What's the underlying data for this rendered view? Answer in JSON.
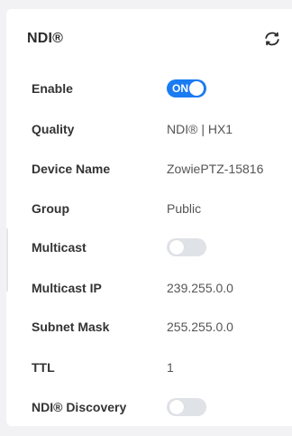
{
  "panel": {
    "title": "NDI®",
    "refresh_icon": "refresh-icon"
  },
  "rows": [
    {
      "label": "Enable",
      "type": "toggle",
      "state": "on",
      "toggle_text": "ON"
    },
    {
      "label": "Quality",
      "type": "text",
      "value": "NDI® | HX1"
    },
    {
      "label": "Device Name",
      "type": "text",
      "value": "ZowiePTZ-15816"
    },
    {
      "label": "Group",
      "type": "text",
      "value": "Public"
    },
    {
      "label": "Multicast",
      "type": "toggle",
      "state": "off"
    },
    {
      "label": "Multicast IP",
      "type": "text",
      "value": "239.255.0.0"
    },
    {
      "label": "Subnet Mask",
      "type": "text",
      "value": "255.255.0.0"
    },
    {
      "label": "TTL",
      "type": "text",
      "value": "1"
    },
    {
      "label": "NDI® Discovery",
      "type": "toggle",
      "state": "off"
    }
  ],
  "colors": {
    "toggle_on": "#1a7bf2",
    "toggle_off": "#dfe2e7"
  }
}
